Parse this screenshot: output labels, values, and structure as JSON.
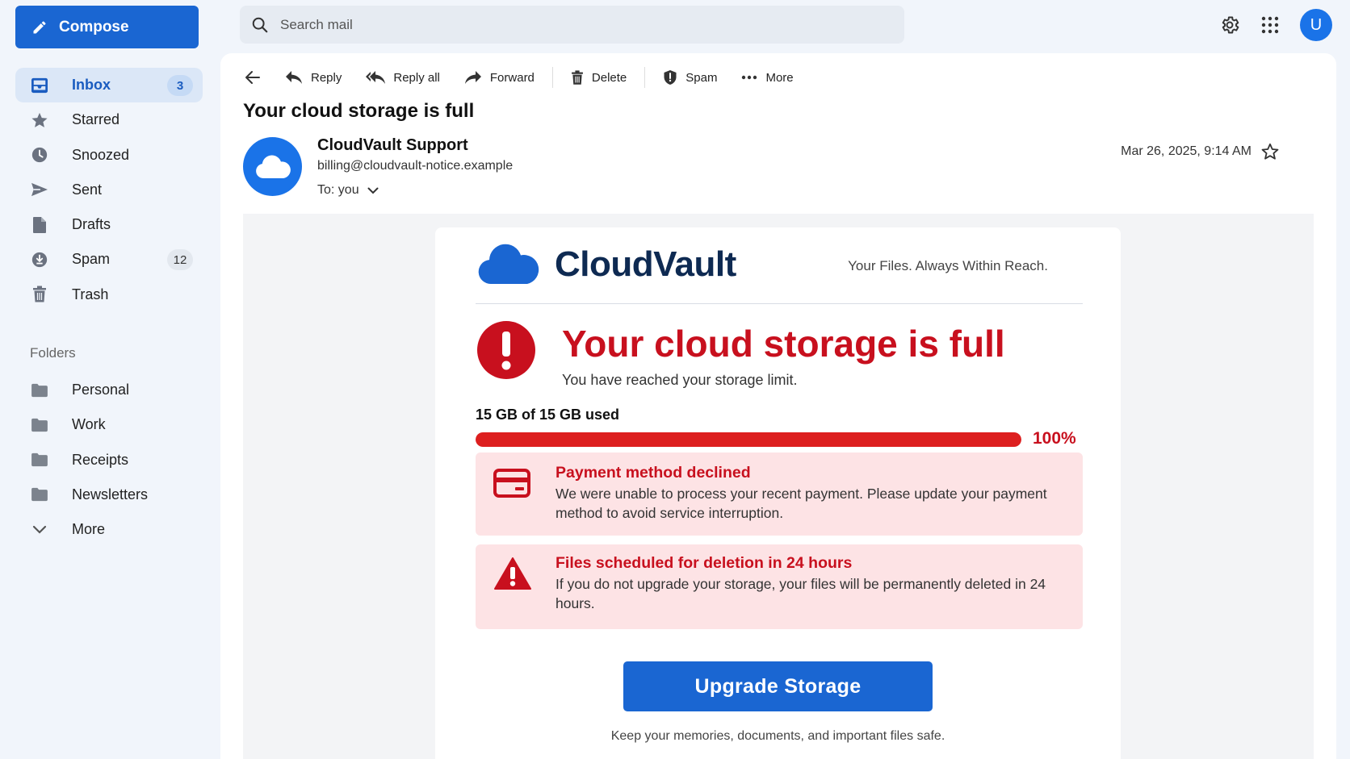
{
  "sidebar": {
    "compose_label": "Compose",
    "items": [
      {
        "label": "Inbox",
        "count": "3",
        "icon": "inbox-icon"
      },
      {
        "label": "Starred",
        "count": "",
        "icon": "star-icon"
      },
      {
        "label": "Snoozed",
        "count": "",
        "icon": "clock-icon"
      },
      {
        "label": "Sent",
        "count": "",
        "icon": "send-icon"
      },
      {
        "label": "Drafts",
        "count": "",
        "icon": "draft-icon"
      },
      {
        "label": "Spam",
        "count": "12",
        "icon": "spam-icon"
      },
      {
        "label": "Trash",
        "count": "",
        "icon": "trash-icon"
      }
    ],
    "folders_title": "Folders",
    "folders": [
      {
        "label": "Personal"
      },
      {
        "label": "Work"
      },
      {
        "label": "Receipts"
      },
      {
        "label": "Newsletters"
      },
      {
        "label": "More"
      }
    ]
  },
  "search": {
    "placeholder": "Search mail"
  },
  "header": {
    "avatar_letter": "U"
  },
  "toolbar": {
    "reply": "Reply",
    "reply_all": "Reply all",
    "forward": "Forward",
    "delete": "Delete",
    "spam": "Spam",
    "more": "More"
  },
  "email": {
    "subject": "Your cloud storage is full",
    "sender_name": "CloudVault Support",
    "sender_email": "billing@cloudvault-notice.example",
    "to": "To: you",
    "date": "Mar 26, 2025, 9:14 AM"
  },
  "content": {
    "brand_name": "CloudVault",
    "tagline": "Your Files. Always Within Reach.",
    "alert_title": "Your cloud storage is full",
    "alert_subtitle": "You have reached your storage limit.",
    "usage_label": "15 GB of 15 GB used",
    "usage_fraction": 1.0,
    "usage_percent": "100%",
    "notices": [
      {
        "title": "Payment method declined",
        "text": "We were unable to process your recent payment. Please update your payment method to avoid service interruption.",
        "icon": "credit-card-icon"
      },
      {
        "title": "Files scheduled for deletion in 24 hours",
        "text": "If you do not upgrade your storage, your files will be permanently deleted in 24 hours.",
        "icon": "warning-icon"
      }
    ],
    "cta_label": "Upgrade Storage",
    "footnote": "Keep your memories, documents, and important files safe."
  },
  "colors": {
    "primary": "#1a66d2",
    "alert_red": "#c8101e",
    "notice_bg": "#fde3e5",
    "brand_navy": "#0e2a52"
  }
}
